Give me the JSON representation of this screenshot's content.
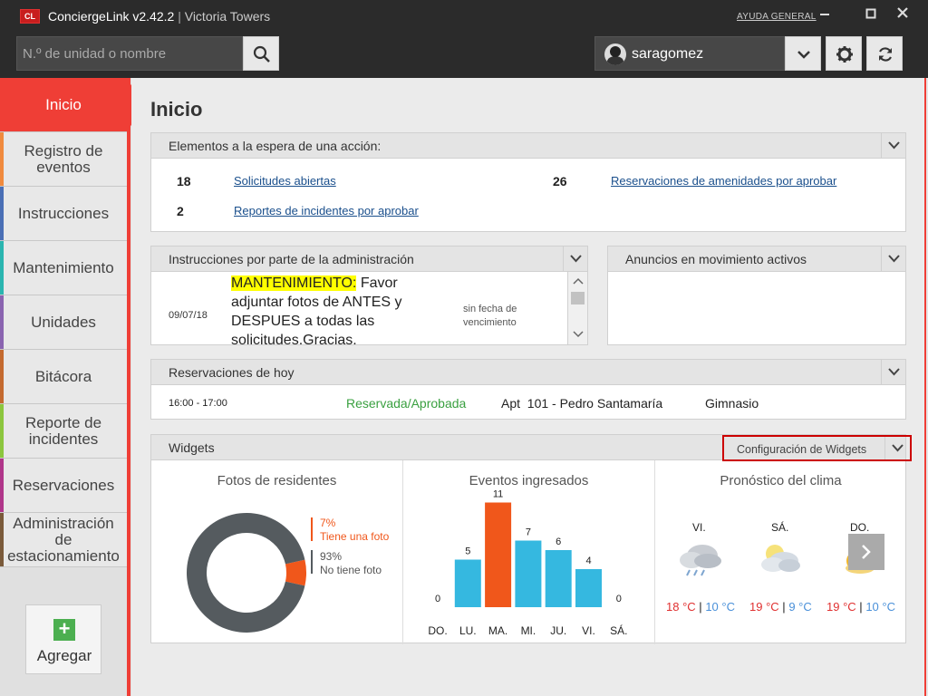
{
  "app": {
    "name": "ConciergeLink v2.42.2",
    "separator": "|",
    "building": "Victoria Towers",
    "logo": "CL",
    "help": "AYUDA GENERAL"
  },
  "search": {
    "placeholder": "N.º de unidad o nombre"
  },
  "user": {
    "name": "saragomez"
  },
  "sidebar": {
    "items": [
      {
        "label": "Inicio",
        "active": true,
        "color": "#ef3e36"
      },
      {
        "label": "Registro de eventos",
        "color": "#f08a3e"
      },
      {
        "label": "Instrucciones",
        "color": "#4a6fb5"
      },
      {
        "label": "Mantenimiento",
        "color": "#2bb5b0"
      },
      {
        "label": "Unidades",
        "color": "#8a64b0"
      },
      {
        "label": "Bitácora",
        "color": "#c46a2f"
      },
      {
        "label": "Reporte de incidentes",
        "color": "#8cc63e"
      },
      {
        "label": "Reservaciones",
        "color": "#b0368a"
      },
      {
        "label": "Administración de estacionamiento",
        "color": "#7a5a3a"
      }
    ],
    "add_label": "Agregar"
  },
  "main": {
    "title": "Inicio",
    "pending": {
      "title": "Elementos a la espera de una acción:",
      "items": [
        {
          "count": "18",
          "label": "Solicitudes abiertas"
        },
        {
          "count": "26",
          "label": "Reservaciones de amenidades por aprobar"
        },
        {
          "count": "2",
          "label": "Reportes de incidentes por aprobar"
        }
      ]
    },
    "instructions": {
      "title": "Instrucciones por parte de la administración",
      "date": "09/07/18",
      "tag": "MANTENIMIENTO:",
      "text": " Favor adjuntar fotos de ANTES y DESPUES a todas las solicitudes.Gracias.",
      "due": "sin fecha de vencimiento"
    },
    "announcements": {
      "title": "Anuncios en movimiento activos"
    },
    "reservations": {
      "title": "Reservaciones de hoy",
      "time": "16:00 - 17:00",
      "status": "Reservada/Aprobada",
      "unit": "Apt  101 - Pedro Santamaría",
      "amenity": "Gimnasio"
    },
    "widgets": {
      "title": "Widgets",
      "config": "Configuración de Widgets",
      "photos": {
        "title": "Fotos de residentes",
        "with_pct": "7%",
        "with_label": "Tiene una foto",
        "without_pct": "93%",
        "without_label": "No tiene foto",
        "color_with": "#f0571b",
        "color_without": "#555b5f"
      },
      "events": {
        "title": "Eventos ingresados"
      },
      "weather": {
        "title": "Pronóstico del clima",
        "days": [
          {
            "day": "VI.",
            "hi": "18 °C",
            "lo": "10 °C",
            "icon": "rain-cloud-icon"
          },
          {
            "day": "SÁ.",
            "hi": "19 °C",
            "lo": "9 °C",
            "icon": "partly-cloudy-icon"
          },
          {
            "day": "DO.",
            "hi": "19 °C",
            "lo": "10 °C",
            "icon": "sun-cloud-icon"
          }
        ],
        "sep": "|"
      }
    }
  },
  "chart_data": [
    {
      "type": "pie",
      "title": "Fotos de residentes",
      "categories": [
        "Tiene una foto",
        "No tiene foto"
      ],
      "values": [
        7,
        93
      ]
    },
    {
      "type": "bar",
      "title": "Eventos ingresados",
      "categories": [
        "DO.",
        "LU.",
        "MA.",
        "MI.",
        "JU.",
        "VI.",
        "SÁ."
      ],
      "values": [
        0,
        5,
        11,
        7,
        6,
        4,
        0
      ],
      "highlight_index": 2,
      "colors": {
        "default": "#35b8e0",
        "highlight": "#f0571b"
      }
    }
  ]
}
